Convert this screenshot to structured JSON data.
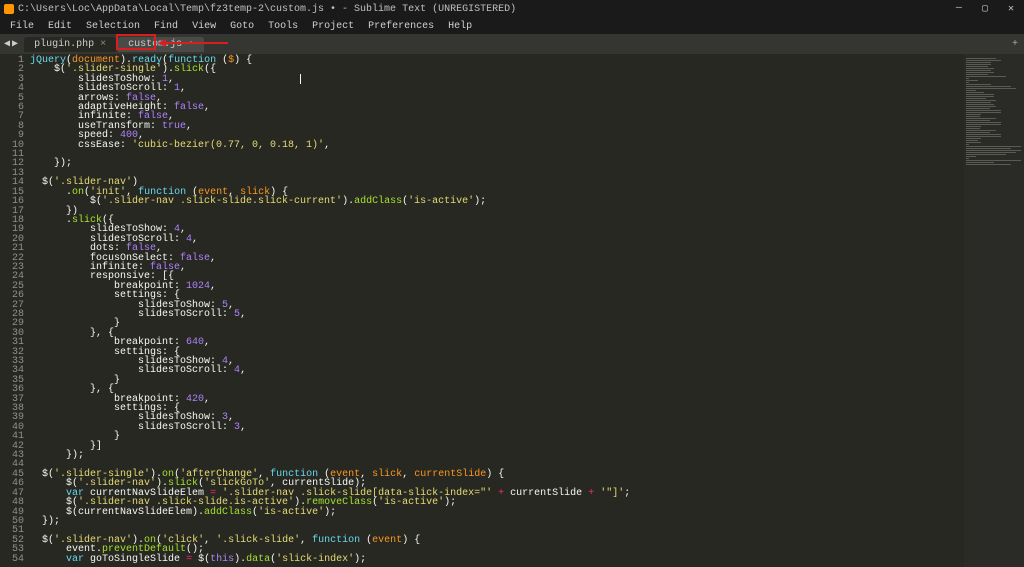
{
  "titlebar": {
    "path": "C:\\Users\\Loc\\AppData\\Local\\Temp\\fz3temp-2\\custom.js • - Sublime Text (UNREGISTERED)",
    "min": "—",
    "max": "▢",
    "close": "✕"
  },
  "menu": {
    "file": "File",
    "edit": "Edit",
    "selection": "Selection",
    "find": "Find",
    "view": "View",
    "goto": "Goto",
    "tools": "Tools",
    "project": "Project",
    "preferences": "Preferences",
    "help": "Help"
  },
  "tabs": {
    "back": "◀",
    "forward": "▶",
    "tab1": "plugin.php",
    "tab2": "custom.js",
    "close_glyph": "×",
    "addtab": "+"
  },
  "code": {
    "lines": [
      {
        "n": 1,
        "t": [
          [
            "c-b",
            "jQuery"
          ],
          [
            "c-w",
            "("
          ],
          [
            "c-o",
            "document"
          ],
          [
            "c-w",
            ")."
          ],
          [
            "c-b",
            "ready"
          ],
          [
            "c-w",
            "("
          ],
          [
            "c-b",
            "function"
          ],
          [
            "c-w",
            " ("
          ],
          [
            "c-o",
            "$"
          ],
          [
            "c-w",
            ") {"
          ]
        ]
      },
      {
        "n": 2,
        "t": [
          [
            "c-w",
            "    $("
          ],
          [
            "c-y",
            "'.slider-single'"
          ],
          [
            "c-w",
            ")."
          ],
          [
            "c-g",
            "slick"
          ],
          [
            "c-w",
            "({"
          ]
        ]
      },
      {
        "n": 3,
        "t": [
          [
            "c-w",
            "        slidesToShow: "
          ],
          [
            "c-n",
            "1"
          ],
          [
            "c-w",
            ","
          ]
        ]
      },
      {
        "n": 4,
        "t": [
          [
            "c-w",
            "        slidesToScroll: "
          ],
          [
            "c-n",
            "1"
          ],
          [
            "c-w",
            ","
          ]
        ]
      },
      {
        "n": 5,
        "t": [
          [
            "c-w",
            "        arrows: "
          ],
          [
            "c-n",
            "false"
          ],
          [
            "c-w",
            ","
          ]
        ]
      },
      {
        "n": 6,
        "t": [
          [
            "c-w",
            "        adaptiveHeight: "
          ],
          [
            "c-n",
            "false"
          ],
          [
            "c-w",
            ","
          ]
        ]
      },
      {
        "n": 7,
        "t": [
          [
            "c-w",
            "        infinite: "
          ],
          [
            "c-n",
            "false"
          ],
          [
            "c-w",
            ","
          ]
        ]
      },
      {
        "n": 8,
        "t": [
          [
            "c-w",
            "        useTransform: "
          ],
          [
            "c-n",
            "true"
          ],
          [
            "c-w",
            ","
          ]
        ]
      },
      {
        "n": 9,
        "t": [
          [
            "c-w",
            "        speed: "
          ],
          [
            "c-n",
            "400"
          ],
          [
            "c-w",
            ","
          ]
        ]
      },
      {
        "n": 10,
        "t": [
          [
            "c-w",
            "        cssEase: "
          ],
          [
            "c-y",
            "'cubic-bezier(0.77, 0, 0.18, 1)'"
          ],
          [
            "c-w",
            ","
          ]
        ]
      },
      {
        "n": 11,
        "t": []
      },
      {
        "n": 12,
        "t": [
          [
            "c-w",
            "    });"
          ]
        ]
      },
      {
        "n": 13,
        "t": []
      },
      {
        "n": 14,
        "t": [
          [
            "c-w",
            "  $("
          ],
          [
            "c-y",
            "'.slider-nav'"
          ],
          [
            "c-w",
            ")"
          ]
        ]
      },
      {
        "n": 15,
        "t": [
          [
            "c-w",
            "      ."
          ],
          [
            "c-g",
            "on"
          ],
          [
            "c-w",
            "("
          ],
          [
            "c-y",
            "'init'"
          ],
          [
            "c-w",
            ", "
          ],
          [
            "c-b",
            "function"
          ],
          [
            "c-w",
            " ("
          ],
          [
            "c-o",
            "event"
          ],
          [
            "c-w",
            ", "
          ],
          [
            "c-o",
            "slick"
          ],
          [
            "c-w",
            ") {"
          ]
        ]
      },
      {
        "n": 16,
        "t": [
          [
            "c-w",
            "          $("
          ],
          [
            "c-y",
            "'.slider-nav .slick-slide.slick-current'"
          ],
          [
            "c-w",
            ")."
          ],
          [
            "c-g",
            "addClass"
          ],
          [
            "c-w",
            "("
          ],
          [
            "c-y",
            "'is-active'"
          ],
          [
            "c-w",
            ");"
          ]
        ]
      },
      {
        "n": 17,
        "t": [
          [
            "c-w",
            "      })"
          ]
        ]
      },
      {
        "n": 18,
        "t": [
          [
            "c-w",
            "      ."
          ],
          [
            "c-g",
            "slick"
          ],
          [
            "c-w",
            "({"
          ]
        ]
      },
      {
        "n": 19,
        "t": [
          [
            "c-w",
            "          slidesToShow: "
          ],
          [
            "c-n",
            "4"
          ],
          [
            "c-w",
            ","
          ]
        ]
      },
      {
        "n": 20,
        "t": [
          [
            "c-w",
            "          slidesToScroll: "
          ],
          [
            "c-n",
            "4"
          ],
          [
            "c-w",
            ","
          ]
        ]
      },
      {
        "n": 21,
        "t": [
          [
            "c-w",
            "          dots: "
          ],
          [
            "c-n",
            "false"
          ],
          [
            "c-w",
            ","
          ]
        ]
      },
      {
        "n": 22,
        "t": [
          [
            "c-w",
            "          focusOnSelect: "
          ],
          [
            "c-n",
            "false"
          ],
          [
            "c-w",
            ","
          ]
        ]
      },
      {
        "n": 23,
        "t": [
          [
            "c-w",
            "          infinite: "
          ],
          [
            "c-n",
            "false"
          ],
          [
            "c-w",
            ","
          ]
        ]
      },
      {
        "n": 24,
        "t": [
          [
            "c-w",
            "          responsive: [{"
          ]
        ]
      },
      {
        "n": 25,
        "t": [
          [
            "c-w",
            "              breakpoint: "
          ],
          [
            "c-n",
            "1024"
          ],
          [
            "c-w",
            ","
          ]
        ]
      },
      {
        "n": 26,
        "t": [
          [
            "c-w",
            "              settings: {"
          ]
        ]
      },
      {
        "n": 27,
        "t": [
          [
            "c-w",
            "                  slidesToShow: "
          ],
          [
            "c-n",
            "5"
          ],
          [
            "c-w",
            ","
          ]
        ]
      },
      {
        "n": 28,
        "t": [
          [
            "c-w",
            "                  slidesToScroll: "
          ],
          [
            "c-n",
            "5"
          ],
          [
            "c-w",
            ","
          ]
        ]
      },
      {
        "n": 29,
        "t": [
          [
            "c-w",
            "              }"
          ]
        ]
      },
      {
        "n": 30,
        "t": [
          [
            "c-w",
            "          }, {"
          ]
        ]
      },
      {
        "n": 31,
        "t": [
          [
            "c-w",
            "              breakpoint: "
          ],
          [
            "c-n",
            "640"
          ],
          [
            "c-w",
            ","
          ]
        ]
      },
      {
        "n": 32,
        "t": [
          [
            "c-w",
            "              settings: {"
          ]
        ]
      },
      {
        "n": 33,
        "t": [
          [
            "c-w",
            "                  slidesToShow: "
          ],
          [
            "c-n",
            "4"
          ],
          [
            "c-w",
            ","
          ]
        ]
      },
      {
        "n": 34,
        "t": [
          [
            "c-w",
            "                  slidesToScroll: "
          ],
          [
            "c-n",
            "4"
          ],
          [
            "c-w",
            ","
          ]
        ]
      },
      {
        "n": 35,
        "t": [
          [
            "c-w",
            "              }"
          ]
        ]
      },
      {
        "n": 36,
        "t": [
          [
            "c-w",
            "          }, {"
          ]
        ]
      },
      {
        "n": 37,
        "t": [
          [
            "c-w",
            "              breakpoint: "
          ],
          [
            "c-n",
            "420"
          ],
          [
            "c-w",
            ","
          ]
        ]
      },
      {
        "n": 38,
        "t": [
          [
            "c-w",
            "              settings: {"
          ]
        ]
      },
      {
        "n": 39,
        "t": [
          [
            "c-w",
            "                  slidesToShow: "
          ],
          [
            "c-n",
            "3"
          ],
          [
            "c-w",
            ","
          ]
        ]
      },
      {
        "n": 40,
        "t": [
          [
            "c-w",
            "                  slidesToScroll: "
          ],
          [
            "c-n",
            "3"
          ],
          [
            "c-w",
            ","
          ]
        ]
      },
      {
        "n": 41,
        "t": [
          [
            "c-w",
            "              }"
          ]
        ]
      },
      {
        "n": 42,
        "t": [
          [
            "c-w",
            "          }]"
          ]
        ]
      },
      {
        "n": 43,
        "t": [
          [
            "c-w",
            "      });"
          ]
        ]
      },
      {
        "n": 44,
        "t": []
      },
      {
        "n": 45,
        "t": [
          [
            "c-w",
            "  $("
          ],
          [
            "c-y",
            "'.slider-single'"
          ],
          [
            "c-w",
            ")."
          ],
          [
            "c-g",
            "on"
          ],
          [
            "c-w",
            "("
          ],
          [
            "c-y",
            "'afterChange'"
          ],
          [
            "c-w",
            ", "
          ],
          [
            "c-b",
            "function"
          ],
          [
            "c-w",
            " ("
          ],
          [
            "c-o",
            "event"
          ],
          [
            "c-w",
            ", "
          ],
          [
            "c-o",
            "slick"
          ],
          [
            "c-w",
            ", "
          ],
          [
            "c-o",
            "currentSlide"
          ],
          [
            "c-w",
            ") {"
          ]
        ]
      },
      {
        "n": 46,
        "t": [
          [
            "c-w",
            "      $("
          ],
          [
            "c-y",
            "'.slider-nav'"
          ],
          [
            "c-w",
            ")."
          ],
          [
            "c-g",
            "slick"
          ],
          [
            "c-w",
            "("
          ],
          [
            "c-y",
            "'slickGoTo'"
          ],
          [
            "c-w",
            ", currentSlide);"
          ]
        ]
      },
      {
        "n": 47,
        "t": [
          [
            "c-w",
            "      "
          ],
          [
            "c-b",
            "var"
          ],
          [
            "c-w",
            " currentNavSlideElem "
          ],
          [
            "c-p",
            "="
          ],
          [
            "c-w",
            " "
          ],
          [
            "c-y",
            "'.slider-nav .slick-slide[data-slick-index=\"'"
          ],
          [
            "c-w",
            " "
          ],
          [
            "c-p",
            "+"
          ],
          [
            "c-w",
            " currentSlide "
          ],
          [
            "c-p",
            "+"
          ],
          [
            "c-w",
            " "
          ],
          [
            "c-y",
            "'\"]'"
          ],
          [
            "c-w",
            ";"
          ]
        ]
      },
      {
        "n": 48,
        "t": [
          [
            "c-w",
            "      $("
          ],
          [
            "c-y",
            "'.slider-nav .slick-slide.is-active'"
          ],
          [
            "c-w",
            ")."
          ],
          [
            "c-g",
            "removeClass"
          ],
          [
            "c-w",
            "("
          ],
          [
            "c-y",
            "'is-active'"
          ],
          [
            "c-w",
            ");"
          ]
        ]
      },
      {
        "n": 49,
        "t": [
          [
            "c-w",
            "      $(currentNavSlideElem)."
          ],
          [
            "c-g",
            "addClass"
          ],
          [
            "c-w",
            "("
          ],
          [
            "c-y",
            "'is-active'"
          ],
          [
            "c-w",
            ");"
          ]
        ]
      },
      {
        "n": 50,
        "t": [
          [
            "c-w",
            "  });"
          ]
        ]
      },
      {
        "n": 51,
        "t": []
      },
      {
        "n": 52,
        "t": [
          [
            "c-w",
            "  $("
          ],
          [
            "c-y",
            "'.slider-nav'"
          ],
          [
            "c-w",
            ")."
          ],
          [
            "c-g",
            "on"
          ],
          [
            "c-w",
            "("
          ],
          [
            "c-y",
            "'click'"
          ],
          [
            "c-w",
            ", "
          ],
          [
            "c-y",
            "'.slick-slide'"
          ],
          [
            "c-w",
            ", "
          ],
          [
            "c-b",
            "function"
          ],
          [
            "c-w",
            " ("
          ],
          [
            "c-o",
            "event"
          ],
          [
            "c-w",
            ") {"
          ]
        ]
      },
      {
        "n": 53,
        "t": [
          [
            "c-w",
            "      event."
          ],
          [
            "c-g",
            "preventDefault"
          ],
          [
            "c-w",
            "();"
          ]
        ]
      },
      {
        "n": 54,
        "t": [
          [
            "c-w",
            "      "
          ],
          [
            "c-b",
            "var"
          ],
          [
            "c-w",
            " goToSingleSlide "
          ],
          [
            "c-p",
            "="
          ],
          [
            "c-w",
            " $("
          ],
          [
            "c-n",
            "this"
          ],
          [
            "c-w",
            ")."
          ],
          [
            "c-g",
            "data"
          ],
          [
            "c-w",
            "("
          ],
          [
            "c-y",
            "'slick-index'"
          ],
          [
            "c-w",
            ");"
          ]
        ]
      }
    ]
  }
}
